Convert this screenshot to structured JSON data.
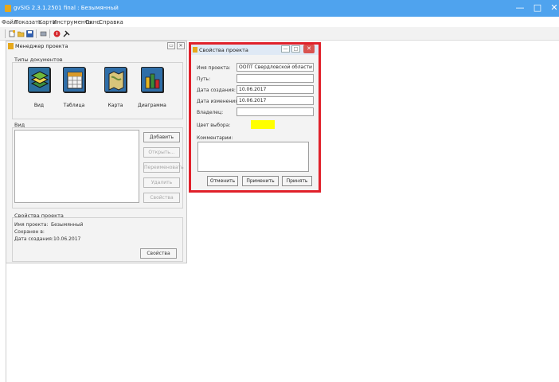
{
  "window": {
    "title": "gvSIG 2.3.1.2501 final : Безымянный",
    "minimize_glyph": "—",
    "maximize_glyph": "□",
    "close_glyph": "✕"
  },
  "menu": [
    "Файл",
    "Показать",
    "Карта",
    "Инструменты",
    "Окно",
    "Справка"
  ],
  "toolbar_icons": [
    "new-project-icon",
    "open-project-icon",
    "save-project-icon",
    "preferences-icon",
    "info-icon",
    "tools-icon"
  ],
  "project_manager": {
    "title": "Менеджер проекта",
    "doc_types_label": "Типы документов",
    "doc_types": [
      {
        "label": "Вид",
        "icon": "view-layers-icon"
      },
      {
        "label": "Таблица",
        "icon": "table-icon"
      },
      {
        "label": "Карта",
        "icon": "map-icon"
      },
      {
        "label": "Диаграмма",
        "icon": "chart-icon"
      }
    ],
    "list_label": "Вид",
    "buttons": {
      "add": "Добавить",
      "open": "Открыть...",
      "rename": "Переименовать",
      "delete": "Удалить",
      "properties": "Свойства"
    },
    "project_props_label": "Свойства проекта",
    "name_label": "Имя проекта:",
    "name_value": "Безымянный",
    "saved_label": "Сохранен в:",
    "saved_value": "",
    "date_label": "Дата создания:",
    "date_value": "10.06.2017",
    "props_button": "Свойства"
  },
  "dialog": {
    "title": "Свойства проекта",
    "accent_color": "#e0202a",
    "fields": {
      "name_label": "Имя проекта:",
      "name_value": "ООПТ Свердловской области",
      "path_label": "Путь:",
      "path_value": "",
      "created_label": "Дата создания:",
      "created_value": "10.06.2017",
      "modified_label": "Дата изменения:",
      "modified_value": "10.06.2017",
      "owner_label": "Владелец:",
      "owner_value": "",
      "selection_color_label": "Цвет выбора:",
      "selection_color": "#ffff00",
      "comments_label": "Комментарии:"
    },
    "buttons": {
      "cancel": "Отменить",
      "apply": "Применить",
      "accept": "Принять"
    }
  }
}
